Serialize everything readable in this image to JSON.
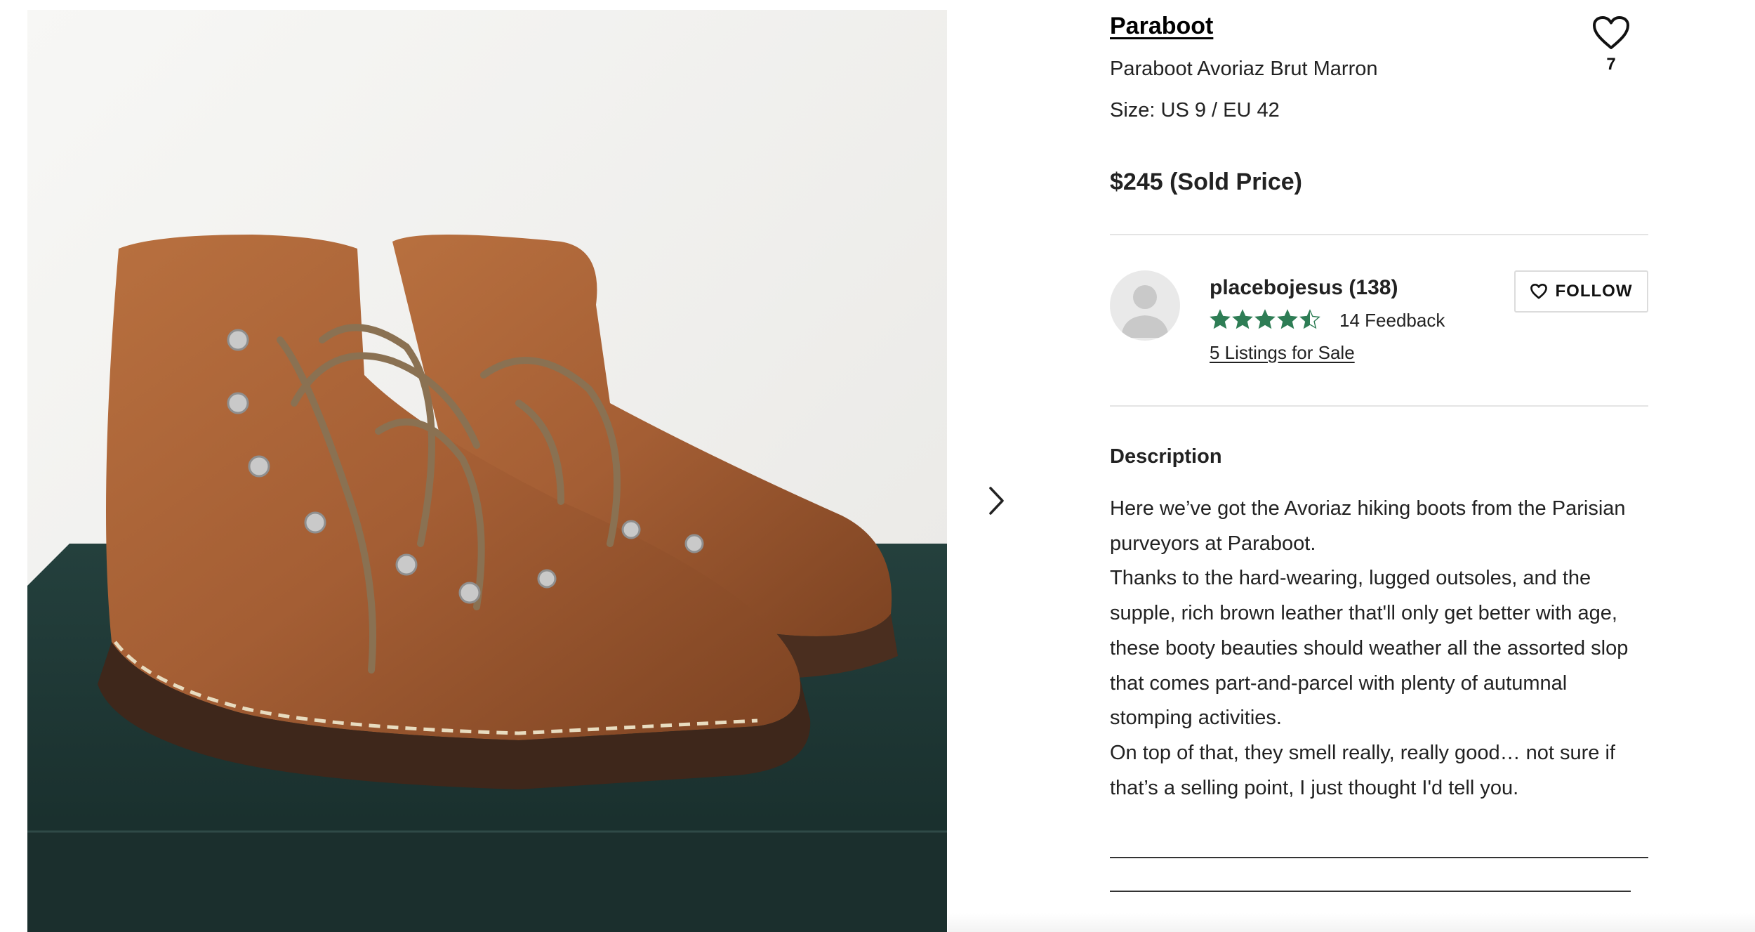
{
  "listing": {
    "designer": "Paraboot",
    "title": "Paraboot Avoriaz Brut Marron",
    "size": "Size: US 9 / EU 42",
    "price": "$245 (Sold Price)",
    "favorite_count": "7"
  },
  "seller": {
    "name": "placebojesus (138)",
    "rating": 4.5,
    "rating_max": 5,
    "feedback": "14 Feedback",
    "listings_link": "5 Listings for Sale",
    "follow_label": "FOLLOW"
  },
  "description": {
    "heading": "Description",
    "paragraphs": [
      "Here we’ve got the Avoriaz hiking boots from the Parisian purveyors at Paraboot.",
      "Thanks to the hard-wearing, lugged outsoles, and the supple, rich brown leather that'll only get better with age, these booty beauties should weather all the assorted slop that comes part-and-parcel with plenty of autumnal stomping activities.",
      "On top of that, they smell really, really good… not sure if that’s a selling point, I just thought I'd tell you."
    ]
  },
  "colors": {
    "star_green": "#2e7d55",
    "leather_brown": "#a45e34",
    "box_green": "#1f3a37"
  },
  "icons": {
    "favorite": "heart-outline-icon",
    "follow": "heart-small-icon",
    "gallery_next": "chevron-right-icon",
    "avatar": "user-placeholder-icon"
  }
}
